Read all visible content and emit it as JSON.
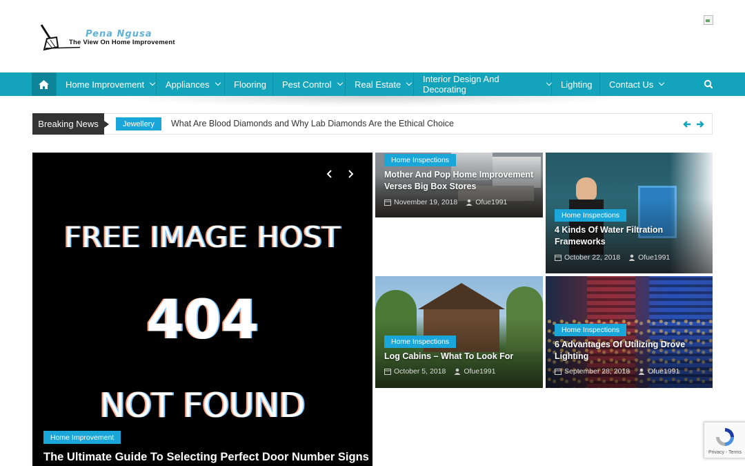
{
  "site": {
    "logo_name": "Pena Ngusa",
    "logo_tagline": "The View On Home Improvement"
  },
  "nav": {
    "items": [
      {
        "label": "Home Improvement",
        "dropdown": true
      },
      {
        "label": "Appliances",
        "dropdown": true
      },
      {
        "label": "Flooring",
        "dropdown": false
      },
      {
        "label": "Pest Control",
        "dropdown": true
      },
      {
        "label": "Real Estate",
        "dropdown": true
      },
      {
        "label": "Interior Design And Decorating",
        "dropdown": true
      },
      {
        "label": "Lighting",
        "dropdown": false
      },
      {
        "label": "Contact Us",
        "dropdown": true
      }
    ]
  },
  "ticker": {
    "label": "Breaking News",
    "category": "Jewellery",
    "headline": "What Are Blood Diamonds and Why Lab Diamonds Are the Ethical Choice"
  },
  "featured": {
    "image_text": [
      "FREE IMAGE HOST",
      "404",
      "NOT FOUND"
    ],
    "category": "Home Improvement",
    "title": "The Ultimate Guide To Selecting Perfect Door Number Signs"
  },
  "posts": [
    {
      "category": "Home Inspections",
      "title": "Mother And Pop Home Improvement Verses Big Box Stores",
      "date": "November 19, 2018",
      "author": "Ofue1991"
    },
    {
      "category": "Home Inspections",
      "title": "4 Kinds Of Water Filtration Frameworks",
      "date": "October 22, 2018",
      "author": "Ofue1991"
    },
    {
      "category": "Home Inspections",
      "title": "Log Cabins – What To Look For",
      "date": "October 5, 2018",
      "author": "Ofue1991"
    },
    {
      "category": "Home Inspections",
      "title": "6 Advantages Of Utilizing Drove Lighting",
      "date": "September 28, 2018",
      "author": "Ofue1991"
    }
  ],
  "recaptcha": {
    "links": "Privacy - Terms"
  },
  "colors": {
    "accent": "#13a4bb",
    "category": "#1aa6d9",
    "dark": "#333333"
  }
}
